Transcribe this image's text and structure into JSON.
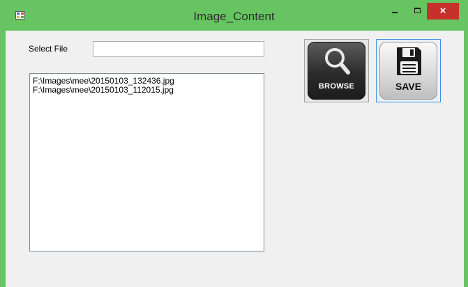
{
  "window": {
    "title": "Image_Content",
    "controls": {
      "minimize": "–",
      "maximize": "□",
      "close": "×"
    }
  },
  "form": {
    "select_file_label": "Select File",
    "file_input_value": "",
    "file_list": [
      "F:\\Images\\mee\\20150103_132436.jpg",
      "F:\\Images\\mee\\20150103_112015.jpg"
    ]
  },
  "buttons": {
    "browse_label": "BROWSE",
    "save_label": "SAVE",
    "browse_icon": "search-icon",
    "save_icon": "floppy-disk-icon"
  },
  "colors": {
    "titlebar": "#67c561",
    "close": "#c7312b",
    "client_bg": "#f0f0f0"
  }
}
